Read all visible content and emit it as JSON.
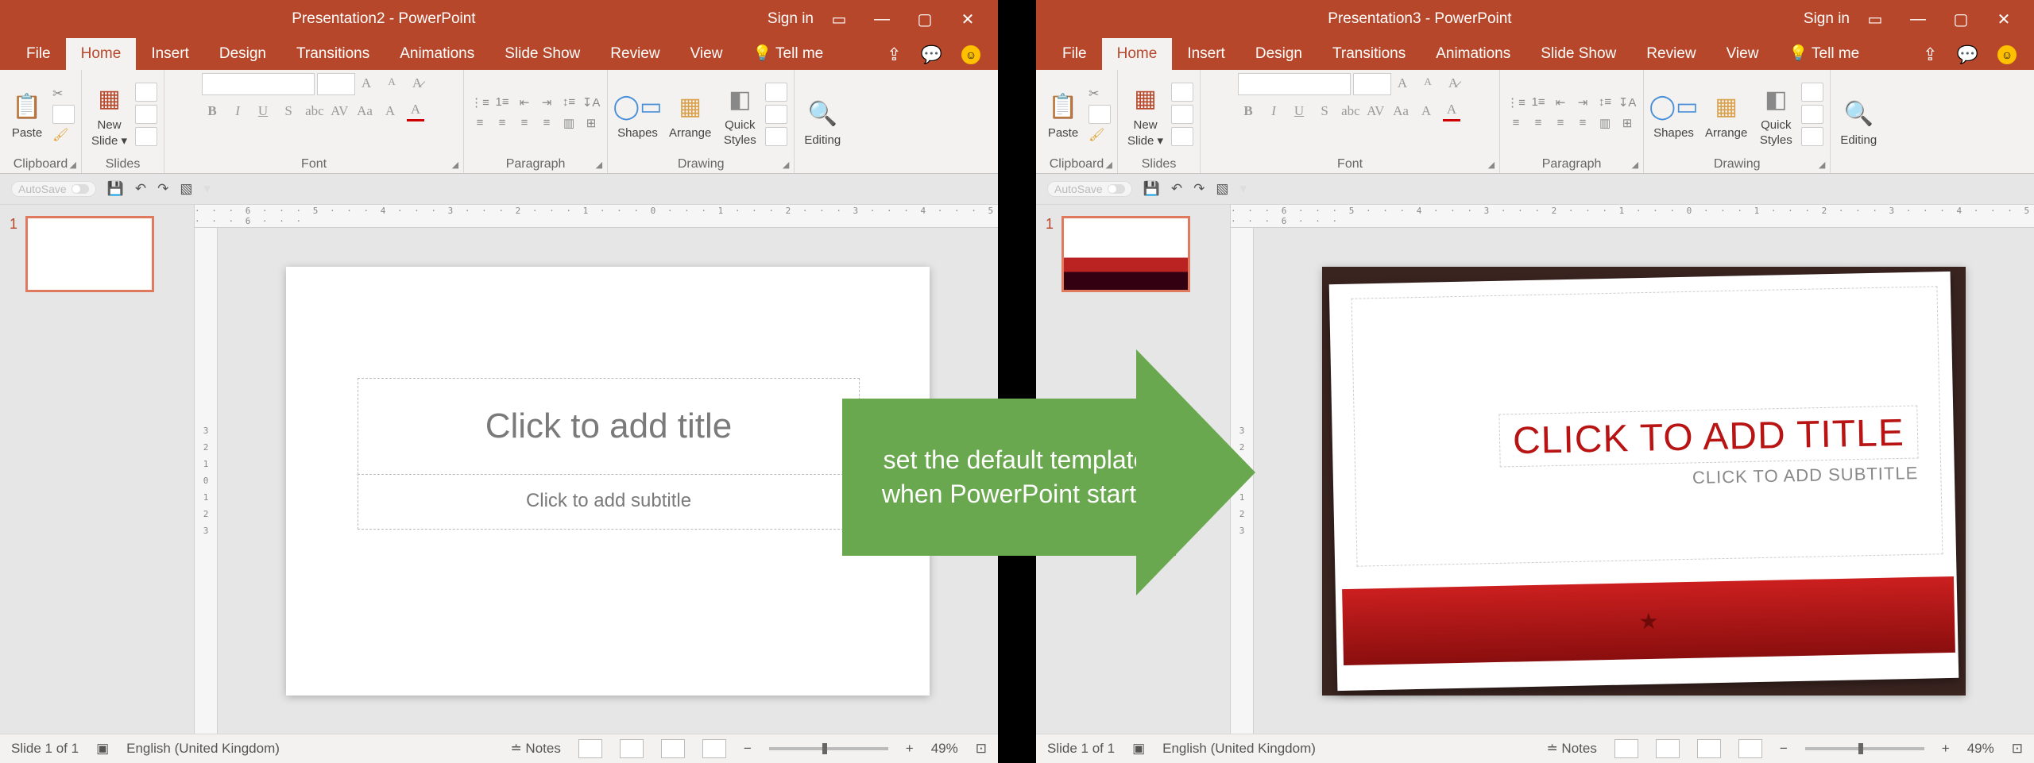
{
  "left": {
    "title": "Presentation2  -  PowerPoint",
    "signin": "Sign in",
    "tabs": {
      "file": "File",
      "home": "Home",
      "insert": "Insert",
      "design": "Design",
      "transitions": "Transitions",
      "animations": "Animations",
      "slideshow": "Slide Show",
      "review": "Review",
      "view": "View",
      "tellme": "Tell me"
    },
    "ribbon": {
      "clipboard": "Clipboard",
      "paste": "Paste",
      "slides": "Slides",
      "newslide_l1": "New",
      "newslide_l2": "Slide",
      "font": "Font",
      "paragraph": "Paragraph",
      "drawing": "Drawing",
      "shapes": "Shapes",
      "arrange": "Arrange",
      "quick_l1": "Quick",
      "quick_l2": "Styles",
      "editing": "Editing"
    },
    "qat": {
      "autosave": "AutoSave",
      "off": "Off"
    },
    "thumb_num": "1",
    "slide": {
      "title": "Click to add title",
      "sub": "Click to add subtitle"
    },
    "status": {
      "slide": "Slide 1 of 1",
      "lang": "English (United Kingdom)",
      "notes": "Notes",
      "zoom": "49%",
      "plus": "+",
      "minus": "−"
    }
  },
  "right": {
    "title": "Presentation3  -  PowerPoint",
    "signin": "Sign in",
    "tabs": {
      "file": "File",
      "home": "Home",
      "insert": "Insert",
      "design": "Design",
      "transitions": "Transitions",
      "animations": "Animations",
      "slideshow": "Slide Show",
      "review": "Review",
      "view": "View",
      "tellme": "Tell me"
    },
    "ribbon": {
      "clipboard": "Clipboard",
      "paste": "Paste",
      "slides": "Slides",
      "newslide_l1": "New",
      "newslide_l2": "Slide",
      "font": "Font",
      "paragraph": "Paragraph",
      "drawing": "Drawing",
      "shapes": "Shapes",
      "arrange": "Arrange",
      "quick_l1": "Quick",
      "quick_l2": "Styles",
      "editing": "Editing"
    },
    "qat": {
      "autosave": "AutoSave",
      "off": "Off"
    },
    "thumb_num": "1",
    "slide": {
      "title": "CLICK TO ADD TITLE",
      "sub": "CLICK TO ADD SUBTITLE"
    },
    "status": {
      "slide": "Slide 1 of 1",
      "lang": "English (United Kingdom)",
      "notes": "Notes",
      "zoom": "49%",
      "plus": "+",
      "minus": "−"
    }
  },
  "arrow": {
    "line1": "set the default template",
    "line2": "when PowerPoint starts"
  },
  "ruler_marks": "· · · 6 · · · 5 · · · 4 · · · 3 · · · 2 · · · 1 · · · 0 · · · 1 · · · 2 · · · 3 · · · 4 · · · 5 · · · 6 · · ·"
}
